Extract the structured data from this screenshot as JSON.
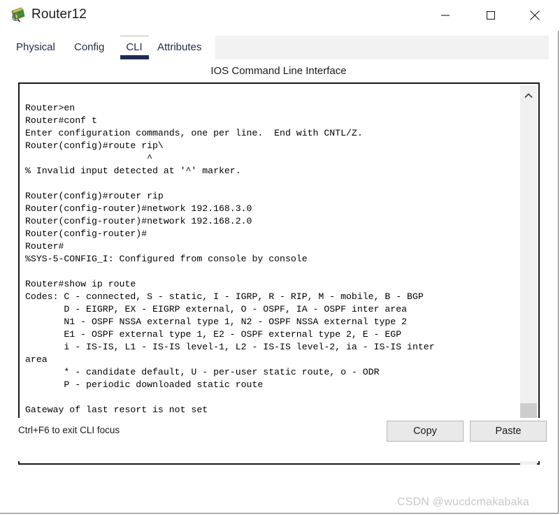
{
  "window": {
    "title": "Router12",
    "icon": "packet-tracer-router-icon",
    "controls": {
      "minimize": "minimize-icon",
      "maximize": "maximize-icon",
      "close": "close-icon"
    }
  },
  "tabs": [
    {
      "label": "Physical",
      "active": false
    },
    {
      "label": "Config",
      "active": false
    },
    {
      "label": "CLI",
      "active": true
    },
    {
      "label": "Attributes",
      "active": false
    }
  ],
  "content": {
    "header": "IOS Command Line Interface",
    "terminal": "\nRouter>en\nRouter#conf t\nEnter configuration commands, one per line.  End with CNTL/Z.\nRouter(config)#route rip\\\n                      ^\n% Invalid input detected at '^' marker.\n\nRouter(config)#router rip\nRouter(config-router)#network 192.168.3.0\nRouter(config-router)#network 192.168.2.0\nRouter(config-router)#\nRouter#\n%SYS-5-CONFIG_I: Configured from console by console\n\nRouter#show ip route\nCodes: C - connected, S - static, I - IGRP, R - RIP, M - mobile, B - BGP\n       D - EIGRP, EX - EIGRP external, O - OSPF, IA - OSPF inter area\n       N1 - OSPF NSSA external type 1, N2 - OSPF NSSA external type 2\n       E1 - OSPF external type 1, E2 - OSPF external type 2, E - EGP\n       i - IS-IS, L1 - IS-IS level-1, L2 - IS-IS level-2, ia - IS-IS inter\narea\n       * - candidate default, U - per-user static route, o - ODR\n       P - periodic downloaded static route\n\nGateway of last resort is not set\n\n\nRouter#",
    "prompt_cursor": true
  },
  "scrollbar": {
    "up_arrow": "chevron-up-icon",
    "down_arrow": "chevron-down-icon",
    "thumb_position_percent": 92
  },
  "bottom": {
    "hint": "Ctrl+F6 to exit CLI focus",
    "copy_label": "Copy",
    "paste_label": "Paste"
  },
  "watermark": "CSDN @wucdcmakabaka",
  "colors": {
    "active_tab_underline": "#1d2a52",
    "tab_text": "#1d2a4d",
    "terminal_bg": "#ffffff",
    "terminal_text": "#000000",
    "button_bg": "#e9e9e9",
    "watermark": "#c8c8c8"
  }
}
